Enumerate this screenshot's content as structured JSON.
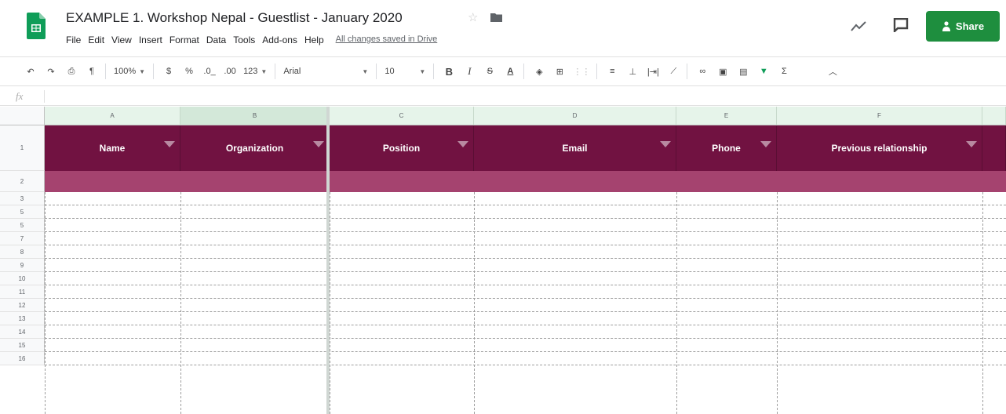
{
  "doc": {
    "title": "EXAMPLE 1. Workshop Nepal - Guestlist - January 2020",
    "saved_status": "All changes saved in Drive",
    "share_label": "Share"
  },
  "menu": [
    "File",
    "Edit",
    "View",
    "Insert",
    "Format",
    "Data",
    "Tools",
    "Add-ons",
    "Help"
  ],
  "toolbar": {
    "zoom": "100%",
    "currency": "$",
    "percent": "%",
    "decrease_decimal": ".0_",
    "increase_decimal": ".00",
    "more_formats": "123",
    "font": "Arial",
    "font_size": "10",
    "bold": "B",
    "italic": "I",
    "strike": "S",
    "text_color": "A",
    "functions": "Σ"
  },
  "formula_bar": {
    "fx_label": "fx"
  },
  "columns": [
    "A",
    "B",
    "C",
    "D",
    "E",
    "F"
  ],
  "rows": [
    "1",
    "2",
    "3",
    "5",
    "5",
    "7",
    "8",
    "9",
    "10",
    "11",
    "12",
    "13",
    "14",
    "15",
    "16"
  ],
  "headers": [
    "Name",
    "Organization",
    "Position",
    "Email",
    "Phone",
    "Previous relationship"
  ],
  "colors": {
    "header_bg": "#711241",
    "band_bg": "#a5436f",
    "share_bg": "#1e8e3e",
    "column_header_bg": "#e6f4ea"
  }
}
